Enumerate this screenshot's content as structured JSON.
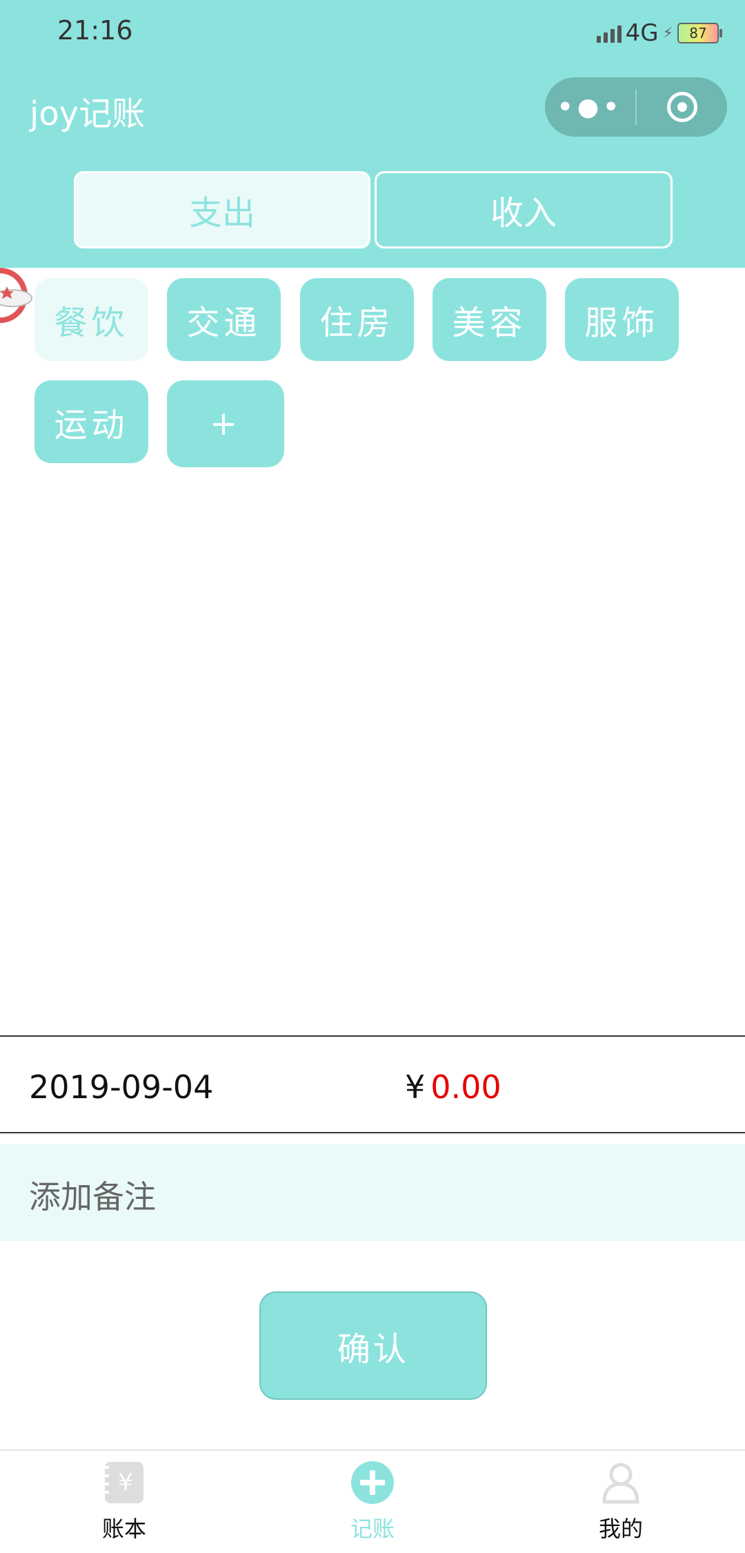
{
  "status_bar": {
    "time": "21:16",
    "network": "4G",
    "battery": "87"
  },
  "header": {
    "title": "joy记账"
  },
  "tabs": [
    {
      "label": "支出",
      "selected": true
    },
    {
      "label": "收入",
      "selected": false
    }
  ],
  "categories": [
    {
      "label": "餐饮",
      "selected": true
    },
    {
      "label": "交通",
      "selected": false
    },
    {
      "label": "住房",
      "selected": false
    },
    {
      "label": "美容",
      "selected": false
    },
    {
      "label": "服饰",
      "selected": false
    },
    {
      "label": "运动",
      "selected": false
    },
    {
      "label": "+",
      "selected": false
    }
  ],
  "entry": {
    "date": "2019-09-04",
    "currency": "¥",
    "amount": "0.00"
  },
  "note": {
    "placeholder": "添加备注"
  },
  "confirm_label": "确认",
  "tabbar": [
    {
      "label": "账本",
      "icon": "ledger-icon",
      "active": false
    },
    {
      "label": "记账",
      "icon": "add-circle-icon",
      "active": true
    },
    {
      "label": "我的",
      "icon": "user-icon",
      "active": false
    }
  ],
  "colors": {
    "primary": "#8ce3de",
    "light": "#eafaf9",
    "amount": "#e60000"
  }
}
